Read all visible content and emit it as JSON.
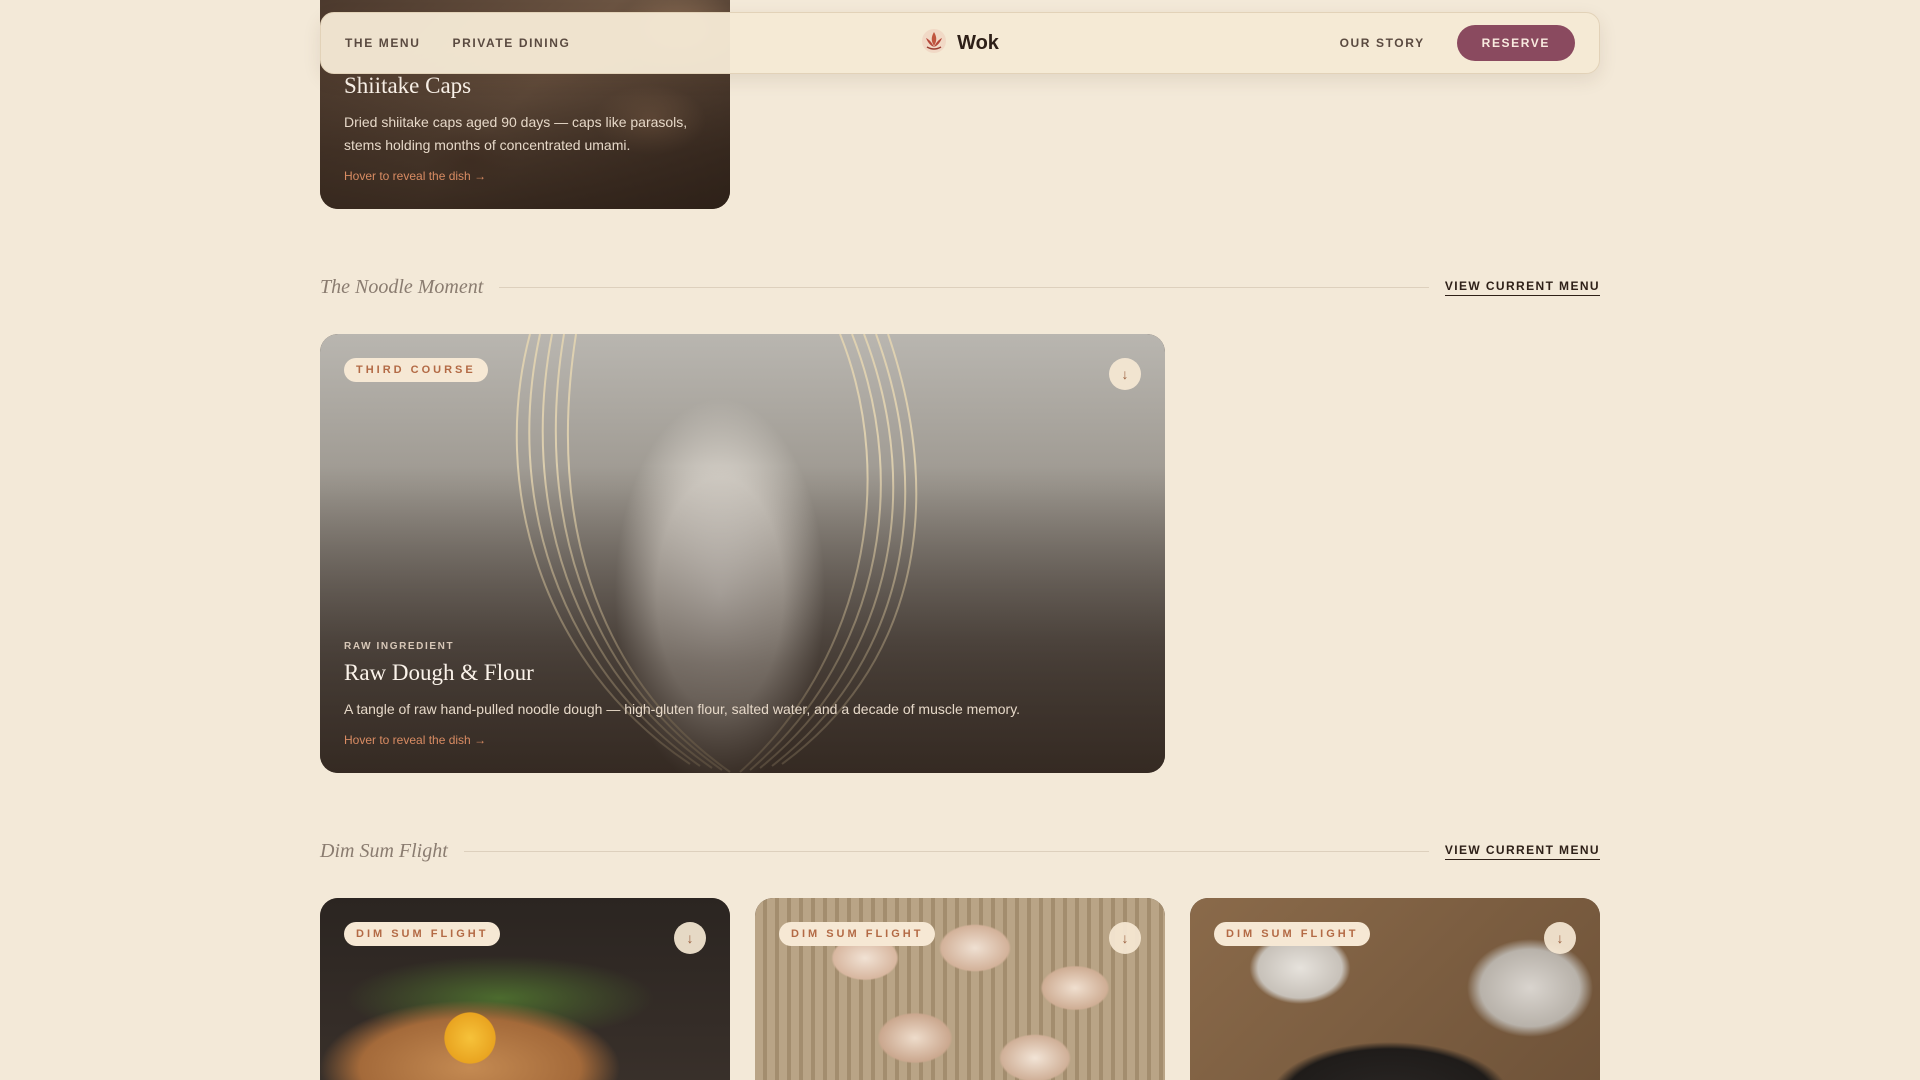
{
  "nav": {
    "links_left": [
      "THE MENU",
      "PRIVATE DINING"
    ],
    "brand": "Wok",
    "link_right": "OUR STORY",
    "reserve": "RESERVE"
  },
  "cards_top": [
    {
      "title": "Shiitake Caps",
      "description": "Dried shiitake caps aged 90 days — caps like parasols, stems holding months of concentrated umami.",
      "hint": "Hover to reveal the dish →"
    }
  ],
  "sections": [
    {
      "title": "The Noodle Moment",
      "link": "VIEW CURRENT MENU",
      "cards": [
        {
          "badge": "THIRD COURSE",
          "kicker": "RAW INGREDIENT",
          "title": "Raw Dough & Flour",
          "description": "A tangle of raw hand-pulled noodle dough — high-gluten flour, salted water, and a decade of muscle memory.",
          "hint": "Hover to reveal the dish →"
        }
      ]
    },
    {
      "title": "Dim Sum Flight",
      "link": "VIEW CURRENT MENU",
      "cards": [
        {
          "badge": "DIM SUM FLIGHT"
        },
        {
          "badge": "DIM SUM FLIGHT"
        },
        {
          "badge": "DIM SUM FLIGHT"
        }
      ]
    }
  ],
  "icons": {
    "brand_logo": "lotus-icon",
    "card_toggle": "arrow-down-icon"
  },
  "colors": {
    "background": "#f3e9d8",
    "accent": "#8a4a5f",
    "badge_text": "#b36a45"
  }
}
